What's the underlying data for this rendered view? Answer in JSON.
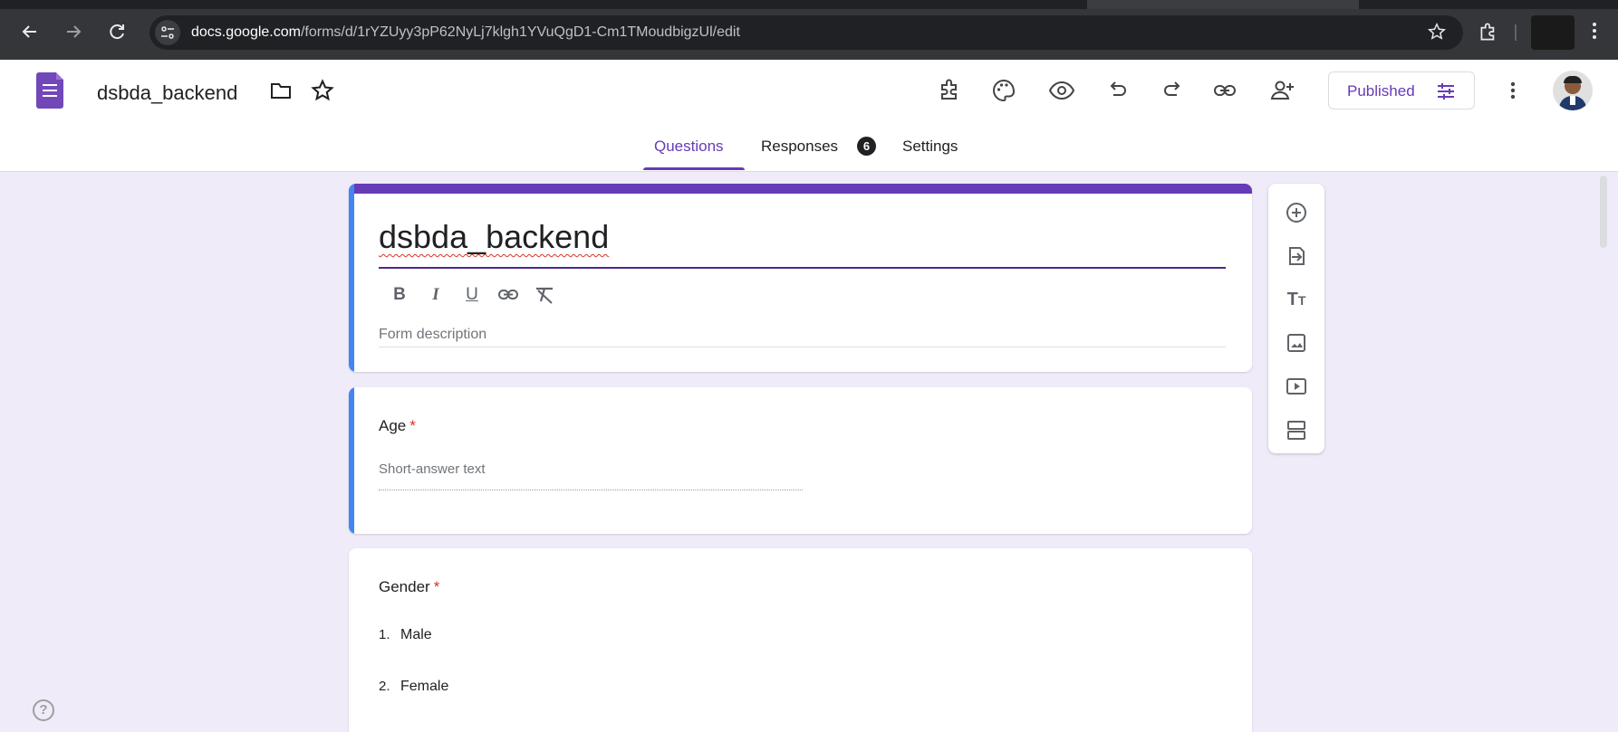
{
  "browser": {
    "url_host": "docs.google.com",
    "url_path": "/forms/d/1rYZUyy3pP62NyLj7klgh1YVuQgD1-Cm1TMoudbigzUl/edit",
    "back_icon": "arrow-left-icon",
    "forward_icon": "arrow-right-icon",
    "reload_icon": "reload-icon",
    "site_info_icon": "tune-icon",
    "bookmark_icon": "star-icon",
    "extensions_icon": "puzzle-icon",
    "menu_icon": "kebab-icon"
  },
  "header": {
    "doc_title": "dsbda_backend",
    "publish_label": "Published",
    "icons": [
      "folder-icon",
      "star-icon",
      "addons-icon",
      "palette-icon",
      "preview-eye-icon",
      "undo-icon",
      "redo-icon",
      "link-icon",
      "add-collaborator-icon",
      "settings-sliders-icon",
      "kebab-icon",
      "avatar"
    ]
  },
  "tabs": {
    "questions": "Questions",
    "responses": "Responses",
    "responses_count": "6",
    "settings": "Settings",
    "active": "questions"
  },
  "form": {
    "title": "dsbda_backend",
    "description_placeholder": "Form description",
    "formatting": {
      "bold": "B",
      "italic": "I",
      "underline": "U"
    },
    "questions": [
      {
        "title": "Age",
        "required": "*",
        "type": "short-answer",
        "hint": "Short-answer text"
      },
      {
        "title": "Gender",
        "required": "*",
        "type": "dropdown",
        "options": [
          {
            "num": "1.",
            "label": "Male"
          },
          {
            "num": "2.",
            "label": "Female"
          }
        ]
      }
    ]
  },
  "side_toolbar": {
    "tools": [
      "add-question-icon",
      "import-questions-icon",
      "title-text-icon",
      "image-icon",
      "video-icon",
      "section-icon"
    ],
    "title_glyph_big": "T",
    "title_glyph_small": "T"
  },
  "colors": {
    "accent": "#673ab7",
    "focus_bar": "#4285f4",
    "background": "#f0ebf8",
    "required": "#d93025"
  },
  "help_glyph": "?"
}
